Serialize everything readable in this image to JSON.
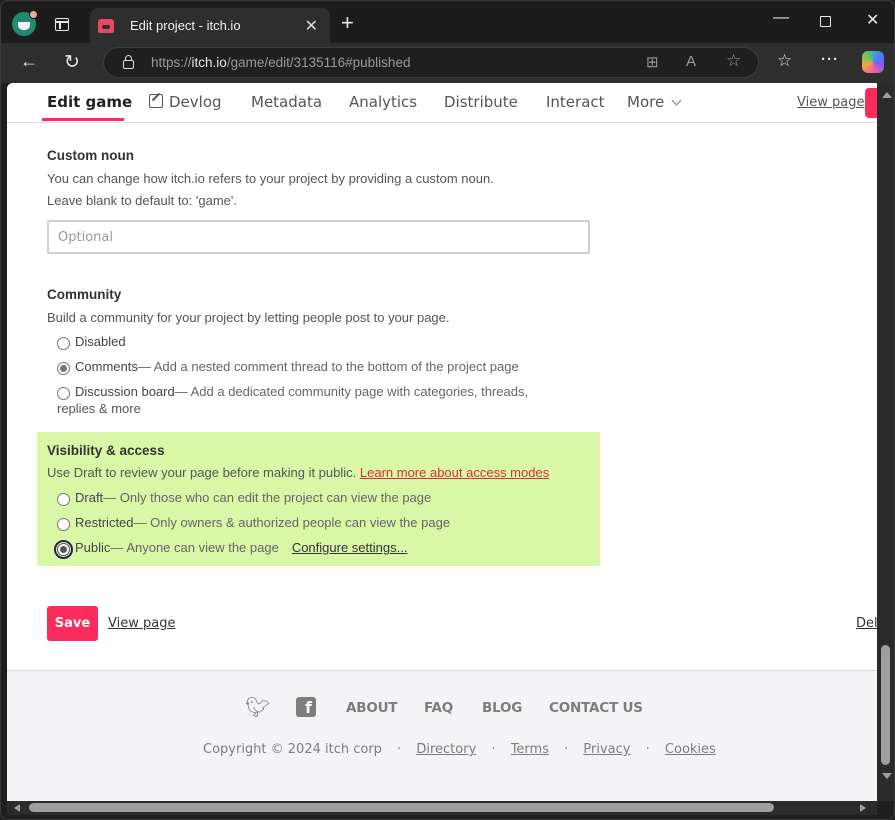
{
  "browser": {
    "tab_title": "Edit project - itch.io",
    "url_scheme": "https://",
    "url_host": "itch.io",
    "url_path": "/game/edit/3135116#published"
  },
  "page_nav": {
    "items": [
      {
        "label": "Edit game",
        "active": true
      },
      {
        "label": "Devlog",
        "icon": "edit-icon"
      },
      {
        "label": "Metadata"
      },
      {
        "label": "Analytics"
      },
      {
        "label": "Distribute"
      },
      {
        "label": "Interact"
      },
      {
        "label": "More",
        "icon": "chevron-down-icon"
      }
    ],
    "view_page": "View page"
  },
  "custom_noun": {
    "title": "Custom noun",
    "description": "You can change how itch.io refers to your project by providing a custom noun.",
    "hint": "Leave blank to default to: 'game'.",
    "placeholder": "Optional",
    "value": ""
  },
  "community": {
    "title": "Community",
    "description": "Build a community for your project by letting people post to your page.",
    "options": [
      {
        "label": "Disabled",
        "description": "",
        "checked": false
      },
      {
        "label": "Comments",
        "description": " — Add a nested comment thread to the bottom of the project page",
        "checked": true
      },
      {
        "label": "Discussion board",
        "description": " — Add a dedicated community page with categories, threads,",
        "description2": "replies & more",
        "checked": false
      }
    ]
  },
  "visibility": {
    "title": "Visibility & access",
    "description": "Use Draft to review your page before making it public. ",
    "learn_more": "Learn more about access modes",
    "options": [
      {
        "label": "Draft",
        "description": " — Only those who can edit the project can view the page",
        "checked": false
      },
      {
        "label": "Restricted",
        "description": " — Only owners & authorized people can view the page",
        "checked": false
      },
      {
        "label": "Public",
        "description": " — Anyone can view the page",
        "checked": true,
        "link": "Configure settings..."
      }
    ],
    "highlight_color": "#daf7a8"
  },
  "actions": {
    "save": "Save",
    "view_page": "View page",
    "delete_partial": "Del"
  },
  "footer": {
    "social": [
      "twitter-icon",
      "facebook-icon"
    ],
    "links": [
      "ABOUT",
      "FAQ",
      "BLOG",
      "CONTACT US"
    ],
    "copyright": "Copyright © 2024 itch corp",
    "separator": "·",
    "bottom_links": [
      "Directory",
      "Terms",
      "Privacy",
      "Cookies"
    ]
  },
  "colors": {
    "accent": "#fa2c5b",
    "link_red": "#da2c3a"
  }
}
